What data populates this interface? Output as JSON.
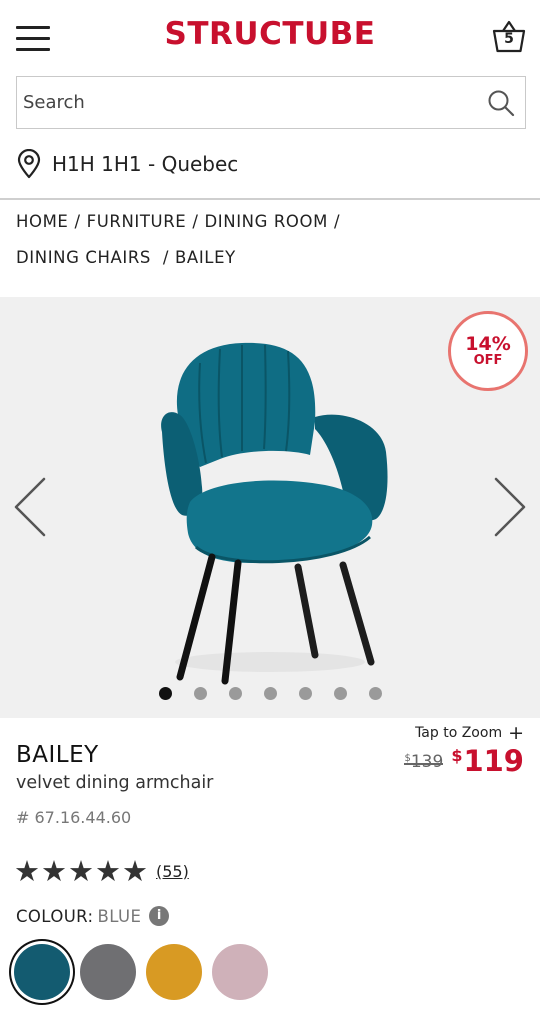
{
  "header": {
    "logo": "STRUCTUBE",
    "cart_count": "5",
    "brand_color": "#c8102e"
  },
  "search": {
    "placeholder": "Search"
  },
  "location": {
    "text": "H1H 1H1 - Quebec"
  },
  "breadcrumb": {
    "items": [
      "HOME",
      "FURNITURE",
      "DINING ROOM",
      "DINING CHAIRS",
      "BAILEY"
    ],
    "separator": "/"
  },
  "gallery": {
    "badge_percent": "14%",
    "badge_off": "OFF",
    "image_count": 7,
    "active_index": 0
  },
  "zoom": {
    "label": "Tap to Zoom",
    "icon": "+"
  },
  "product": {
    "name": "BAILEY",
    "description": "velvet dining armchair",
    "sku": "# 67.16.44.60",
    "old_price_currency": "$",
    "old_price": "139",
    "new_price_currency": "$",
    "new_price": "119"
  },
  "rating": {
    "stars": 5,
    "reviews": "(55)"
  },
  "colour": {
    "label": "COLOUR:",
    "value": "BLUE",
    "info_icon": "i",
    "swatches": [
      {
        "name": "blue",
        "color": "#135b70"
      },
      {
        "name": "grey",
        "color": "#6f6f72"
      },
      {
        "name": "yellow",
        "color": "#d89a23"
      },
      {
        "name": "pink",
        "color": "#cfb1b9"
      }
    ],
    "selected_index": 0
  }
}
